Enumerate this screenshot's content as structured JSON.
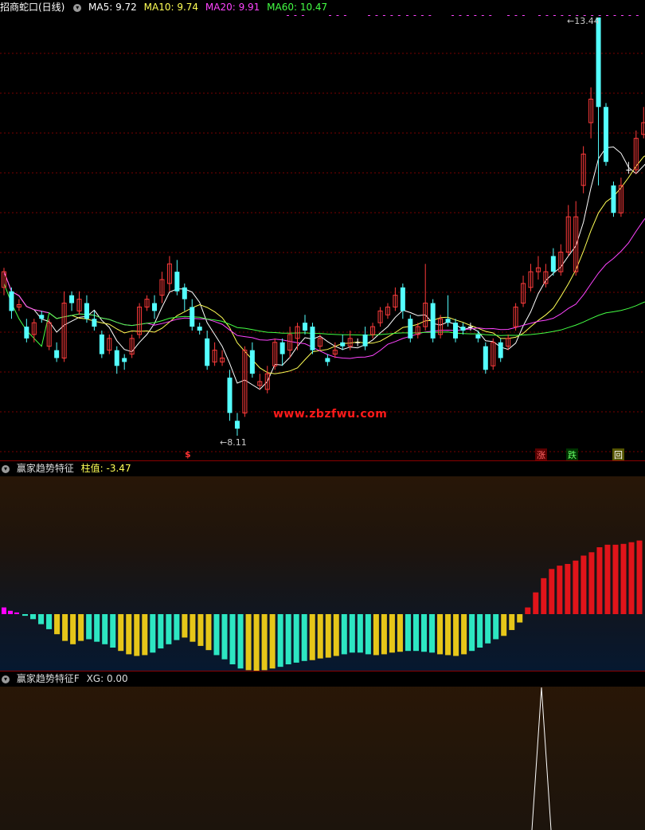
{
  "main": {
    "title": "招商蛇口(日线)",
    "ma_labels": [
      {
        "text": "MA5: 9.72",
        "color": "#ffffff"
      },
      {
        "text": "MA10: 9.74",
        "color": "#ffff55"
      },
      {
        "text": "MA20: 9.91",
        "color": "#ff44ff"
      },
      {
        "text": "MA60: 10.47",
        "color": "#44ff44"
      }
    ],
    "high_label": "13.44",
    "low_label": "8.11",
    "watermark": "www.zbzfwu.com",
    "signals": [
      {
        "text": "$",
        "color": "#ff3333"
      },
      {
        "text": "涨",
        "color": "#ff6666"
      },
      {
        "text": "跌",
        "color": "#66ff66"
      },
      {
        "text": "回",
        "color": "#ffffff"
      }
    ],
    "colors": {
      "up": "#ff3b3b",
      "down": "#54ffff",
      "grid": "#8b0000"
    }
  },
  "indicator1": {
    "name": "赢家趋势特征",
    "value_label": "柱值: -3.47",
    "bar_colors": {
      "magenta": "#ff00ff",
      "cyan": "#2de6c2",
      "yellow": "#e6c619",
      "red": "#e0141a"
    }
  },
  "indicator2": {
    "name": "赢家趋势特征F",
    "value_label": "XG: 0.00"
  }
}
